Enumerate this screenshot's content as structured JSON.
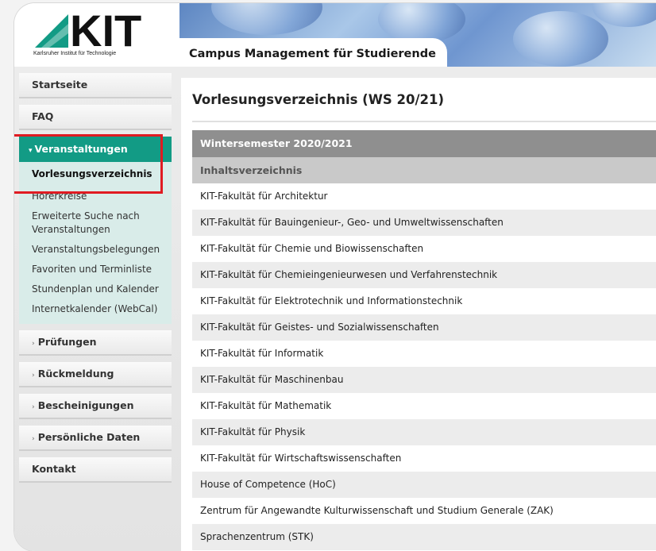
{
  "header": {
    "logo_text": "KIT",
    "logo_subtitle": "Karlsruher Institut für Technologie",
    "banner_title": "Campus Management für Studierende"
  },
  "sidebar": {
    "items_top": [
      {
        "label": "Startseite"
      },
      {
        "label": "FAQ"
      }
    ],
    "active_section": {
      "label": "Veranstaltungen",
      "sub_items": [
        {
          "label": "Vorlesungsverzeichnis",
          "current": true
        },
        {
          "label": "Hörerkreise"
        },
        {
          "label": "Erweiterte Suche nach Veranstaltungen"
        },
        {
          "label": "Veranstaltungsbelegungen"
        },
        {
          "label": "Favoriten und Terminliste"
        },
        {
          "label": "Stundenplan und Kalender"
        },
        {
          "label": "Internetkalender (WebCal)"
        }
      ]
    },
    "items_bottom": [
      {
        "label": "Prüfungen",
        "expandable": true
      },
      {
        "label": "Rückmeldung",
        "expandable": true
      },
      {
        "label": "Bescheinigungen",
        "expandable": true
      },
      {
        "label": "Persönliche Daten",
        "expandable": true
      },
      {
        "label": "Kontakt",
        "expandable": false
      }
    ],
    "highlight_color": "#e01b22",
    "active_color": "#129b85"
  },
  "main": {
    "title": "Vorlesungsverzeichnis (WS 20/21)",
    "semester_header": "Wintersemester 2020/2021",
    "toc_label": "Inhaltsverzeichnis",
    "entries": [
      "KIT-Fakultät für Architektur",
      "KIT-Fakultät für Bauingenieur-, Geo- und Umweltwissenschaften",
      "KIT-Fakultät für Chemie und Biowissenschaften",
      "KIT-Fakultät für Chemieingenieurwesen und Verfahrenstechnik",
      "KIT-Fakultät für Elektrotechnik und Informationstechnik",
      "KIT-Fakultät für Geistes- und Sozialwissenschaften",
      "KIT-Fakultät für Informatik",
      "KIT-Fakultät für Maschinenbau",
      "KIT-Fakultät für Mathematik",
      "KIT-Fakultät für Physik",
      "KIT-Fakultät für Wirtschaftswissenschaften",
      "House of Competence (HoC)",
      "Zentrum für Angewandte Kulturwissenschaft und Studium Generale (ZAK)",
      "Sprachenzentrum (STK)"
    ]
  }
}
